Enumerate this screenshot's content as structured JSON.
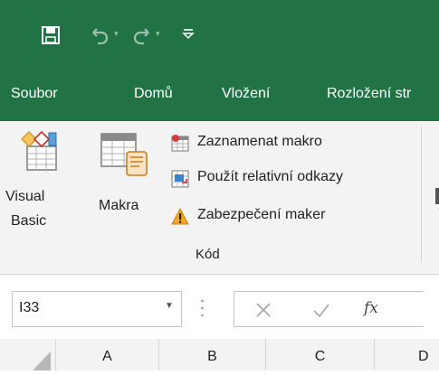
{
  "qat": {
    "save_icon": "save-icon",
    "undo_icon": "undo-icon",
    "redo_icon": "redo-icon",
    "customize_icon": "customize-qat-icon"
  },
  "tabs": [
    "Soubor",
    "Domů",
    "Vložení",
    "Rozložení str"
  ],
  "ribbon": {
    "visual_basic": [
      "Visual",
      "Basic"
    ],
    "macros": "Makra",
    "record_macro": "Zaznamenat makro",
    "relative_refs": "Použít relativní odkazy",
    "macro_security": "Zabezpečení maker",
    "group_label": "Kód"
  },
  "formula_bar": {
    "name_box_value": "I33",
    "fx_label": "fx"
  },
  "columns": [
    "A",
    "B",
    "C",
    "D"
  ],
  "colors": {
    "accent": "#217346",
    "ribbon_bg": "#f3f3f3"
  }
}
